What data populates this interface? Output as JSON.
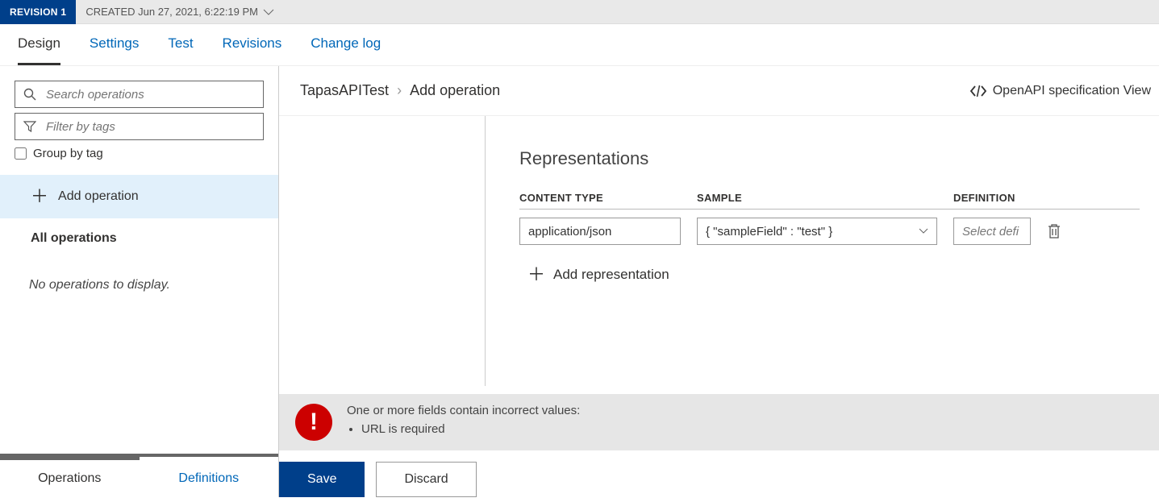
{
  "topbar": {
    "revision_label": "REVISION 1",
    "created_label": "CREATED Jun 27, 2021, 6:22:19 PM"
  },
  "tabs": {
    "design": "Design",
    "settings": "Settings",
    "test": "Test",
    "revisions": "Revisions",
    "changelog": "Change log"
  },
  "sidebar": {
    "search_placeholder": "Search operations",
    "filter_placeholder": "Filter by tags",
    "group_by_label": "Group by tag",
    "add_operation": "Add operation",
    "all_operations": "All operations",
    "empty_text": "No operations to display.",
    "bottom_tabs": {
      "operations": "Operations",
      "definitions": "Definitions"
    }
  },
  "breadcrumb": {
    "api_name": "TapasAPITest",
    "current": "Add operation"
  },
  "openapi_link": "OpenAPI specification View",
  "representations": {
    "heading": "Representations",
    "columns": {
      "content_type": "CONTENT TYPE",
      "sample": "SAMPLE",
      "definition": "DEFINITION"
    },
    "row": {
      "content_type": "application/json",
      "sample": "{ \"sampleField\" : \"test\" }",
      "definition_placeholder": "Select defi"
    },
    "add_label": "Add representation"
  },
  "error": {
    "title": "One or more fields contain incorrect values:",
    "items": [
      "URL is required"
    ]
  },
  "actions": {
    "save": "Save",
    "discard": "Discard"
  }
}
